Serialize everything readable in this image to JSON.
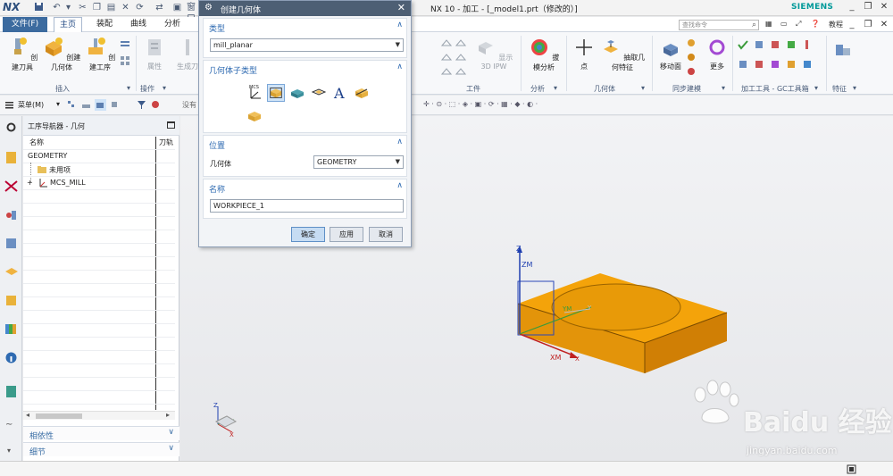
{
  "app": {
    "logo": "NX",
    "window_title": "NX 10 - 加工 - [_model1.prt（修改的）]",
    "brand": "SIEMENS",
    "search_placeholder": "查找命令",
    "help_label": "教程"
  },
  "tabs": [
    {
      "label": "文件(F)"
    },
    {
      "label": "主页"
    },
    {
      "label": "装配"
    },
    {
      "label": "曲线"
    },
    {
      "label": "分析"
    }
  ],
  "ribbon": {
    "buttons": {
      "create_tool": "创建刀具",
      "create_geometry": "创建几何体",
      "create_operation": "创建工序",
      "attributes": "属性",
      "generate_toolpath": "生成刀",
      "show_3d_ipw": "显示 3D IPW",
      "draft_analysis": "拔模分析",
      "point": "点",
      "extract_geometry": "抽取几何特征",
      "move_face": "移动面",
      "more": "更多"
    },
    "groups": {
      "insert": "插入",
      "operations": "操作",
      "workpiece": "工件",
      "analysis": "分析",
      "geometry": "几何体",
      "sync_modeling": "同步建模",
      "gc_toolkit": "加工工具 - GC工具箱",
      "feature": "特征"
    },
    "window_label": "窗口"
  },
  "toolbar": {
    "menu_label": "菜单(M)",
    "filter_placeholder": "没有"
  },
  "navigator": {
    "title": "工序导航器 - 几何",
    "columns": [
      "名称",
      "刀轨"
    ],
    "rows": [
      {
        "label": "GEOMETRY"
      },
      {
        "label": "未用项"
      },
      {
        "label": "MCS_MILL"
      }
    ],
    "panels": {
      "dependencies": "相依性",
      "details": "细节"
    }
  },
  "dialog": {
    "title": "创建几何体",
    "type_section": "类型",
    "type_value": "mill_planar",
    "subtype_section": "几何体子类型",
    "location_section": "位置",
    "geometry_label": "几何体",
    "geometry_value": "GEOMETRY",
    "name_section": "名称",
    "name_value": "WORKPIECE_1",
    "ok": "确定",
    "apply": "应用",
    "cancel": "取消"
  },
  "viewport": {
    "axis_z": "Z",
    "axis_zm": "ZM",
    "axis_xm": "XM",
    "axis_x": "X",
    "axis_ym": "YM",
    "axis_y": "Y",
    "triad_z": "Z",
    "triad_x": "X"
  },
  "watermark": {
    "brand": "Baidu 经验",
    "url": "jingyan.baidu.com"
  },
  "colors": {
    "part": "#f5a50c",
    "accent": "#3c6b9f",
    "dialog_title": "#4d5f74"
  }
}
